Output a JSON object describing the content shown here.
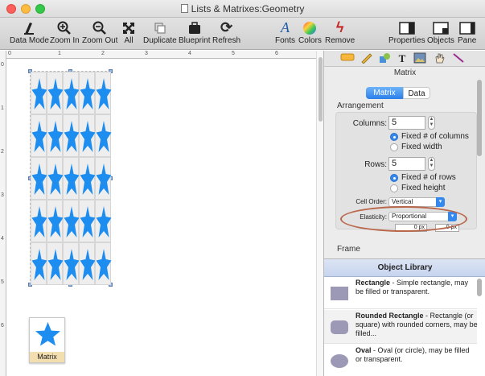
{
  "window": {
    "title": "Lists & Matrixes:Geometry"
  },
  "toolbar": {
    "data_mode": "Data Mode",
    "zoom_in": "Zoom In",
    "zoom_out": "Zoom Out",
    "all": "All",
    "duplicate": "Duplicate",
    "blueprint": "Blueprint",
    "refresh": "Refresh",
    "fonts": "Fonts",
    "colors": "Colors",
    "remove": "Remove",
    "properties": "Properties",
    "objects": "Objects",
    "pane": "Pane"
  },
  "ruler": {
    "top_numbers": [
      "0",
      "1",
      "2",
      "3",
      "4",
      "5",
      "6"
    ],
    "left_numbers": [
      "0",
      "1",
      "2",
      "3",
      "4",
      "5",
      "6"
    ]
  },
  "matrix": {
    "rows": 5,
    "columns": 5,
    "shape_color": "#1e8df0"
  },
  "canvas_thumbnail": {
    "label": "Matrix"
  },
  "panel": {
    "heading": "Matrix",
    "tabs": {
      "matrix": "Matrix",
      "data": "Data"
    },
    "arrangement_label": "Arrangement",
    "columns_label": "Columns:",
    "columns_value": "5",
    "fixed_columns": "Fixed # of columns",
    "fixed_width": "Fixed width",
    "rows_label": "Rows:",
    "rows_value": "5",
    "fixed_rows": "Fixed # of rows",
    "fixed_height": "Fixed height",
    "cell_order_label": "Cell Order:",
    "cell_order_value": "Vertical",
    "elasticity_label": "Elasticity:",
    "elasticity_value": "Proportional",
    "gap_h": "0 px",
    "gap_v": "0 px",
    "frame_label": "Frame"
  },
  "library": {
    "title": "Object Library",
    "items": [
      {
        "name": "Rectangle",
        "desc": " - Simple rectangle, may be filled or transparent."
      },
      {
        "name": "Rounded Rectangle",
        "desc": " - Rectangle (or square) with rounded corners, may be filled..."
      },
      {
        "name": "Oval",
        "desc": " - Oval (or circle), may be filled or transparent."
      }
    ]
  }
}
